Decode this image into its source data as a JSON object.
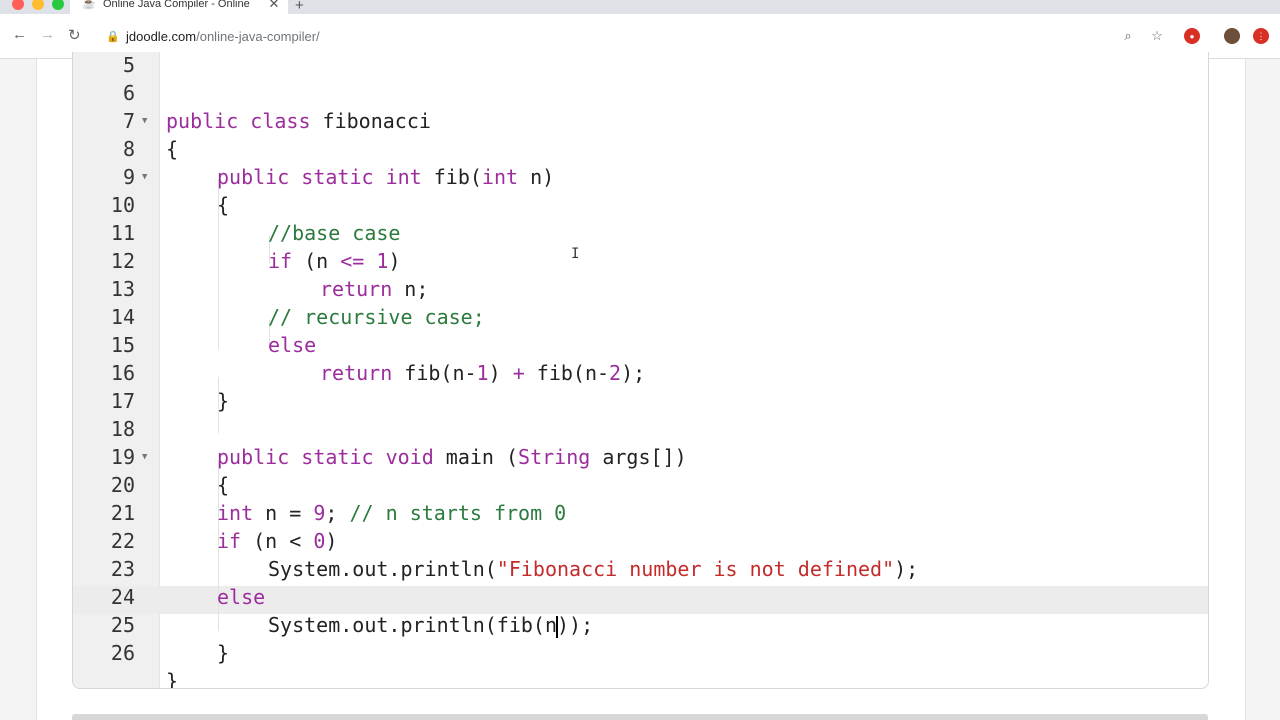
{
  "browser": {
    "tab_title": "Online Java Compiler - Online",
    "tab_close": "✕",
    "new_tab": "+",
    "url_host": "jdoodle.com",
    "url_path": "/online-java-compiler/",
    "back": "←",
    "forward": "→",
    "reload": "↻"
  },
  "colors": {
    "keyword": "#9c2d9c",
    "string": "#c42b2b",
    "comment": "#2b7a3e",
    "gutter": "#f0f0f0",
    "active_line": "#ececec"
  },
  "icons": [
    "zoom-icon",
    "bookmark-star-icon",
    "extension-icon",
    "profile-avatar-icon",
    "menu-icon"
  ],
  "editor": {
    "lines": [
      {
        "n": "5",
        "fold": false
      },
      {
        "n": "6",
        "fold": false
      },
      {
        "n": "7",
        "fold": true
      },
      {
        "n": "8",
        "fold": false
      },
      {
        "n": "9",
        "fold": true
      },
      {
        "n": "10",
        "fold": false
      },
      {
        "n": "11",
        "fold": false
      },
      {
        "n": "12",
        "fold": false
      },
      {
        "n": "13",
        "fold": false
      },
      {
        "n": "14",
        "fold": false
      },
      {
        "n": "15",
        "fold": false
      },
      {
        "n": "16",
        "fold": false
      },
      {
        "n": "17",
        "fold": false
      },
      {
        "n": "18",
        "fold": false
      },
      {
        "n": "19",
        "fold": true
      },
      {
        "n": "20",
        "fold": false
      },
      {
        "n": "21",
        "fold": false
      },
      {
        "n": "22",
        "fold": false
      },
      {
        "n": "23",
        "fold": false
      },
      {
        "n": "24",
        "fold": false
      },
      {
        "n": "25",
        "fold": false
      },
      {
        "n": "26",
        "fold": false
      }
    ],
    "code": {
      "l6_kw": "public class",
      "l6_name": " fibonacci",
      "l7": "{",
      "l8_kw": "public static int",
      "l8_rest": " fib(",
      "l8_kw2": "int",
      "l8_end": " n)",
      "l9": "{",
      "l10": "//base case",
      "l11_kw": "if",
      "l11_a": " (n ",
      "l11_op": "<=",
      "l11_b": " ",
      "l11_num": "1",
      "l11_c": ")",
      "l12_kw": "return",
      "l12_rest": " n;",
      "l13": "// recursive case;",
      "l14": "else",
      "l15_kw": "return",
      "l15_a": " fib(n-",
      "l15_n1": "1",
      "l15_b": ") ",
      "l15_op": "+",
      "l15_c": " fib(n-",
      "l15_n2": "2",
      "l15_d": ");",
      "l16": "}",
      "l18_kw": "public static void",
      "l18_rest": " main (",
      "l18_type": "String",
      "l18_end": " args[])",
      "l19": "{",
      "l20_kw": "int",
      "l20_a": " n = ",
      "l20_num": "9",
      "l20_b": "; ",
      "l20_cm": "// n starts from 0",
      "l21_kw": "if",
      "l21_a": " (n < ",
      "l21_num": "0",
      "l21_b": ")",
      "l22_a": "System.out.println(",
      "l22_str": "\"Fibonacci number is not defined\"",
      "l22_b": ");",
      "l23": "else",
      "l24_a": "System.out.println(fib(n",
      "l24_b": "));",
      "l25": "}",
      "l26": "}"
    }
  }
}
